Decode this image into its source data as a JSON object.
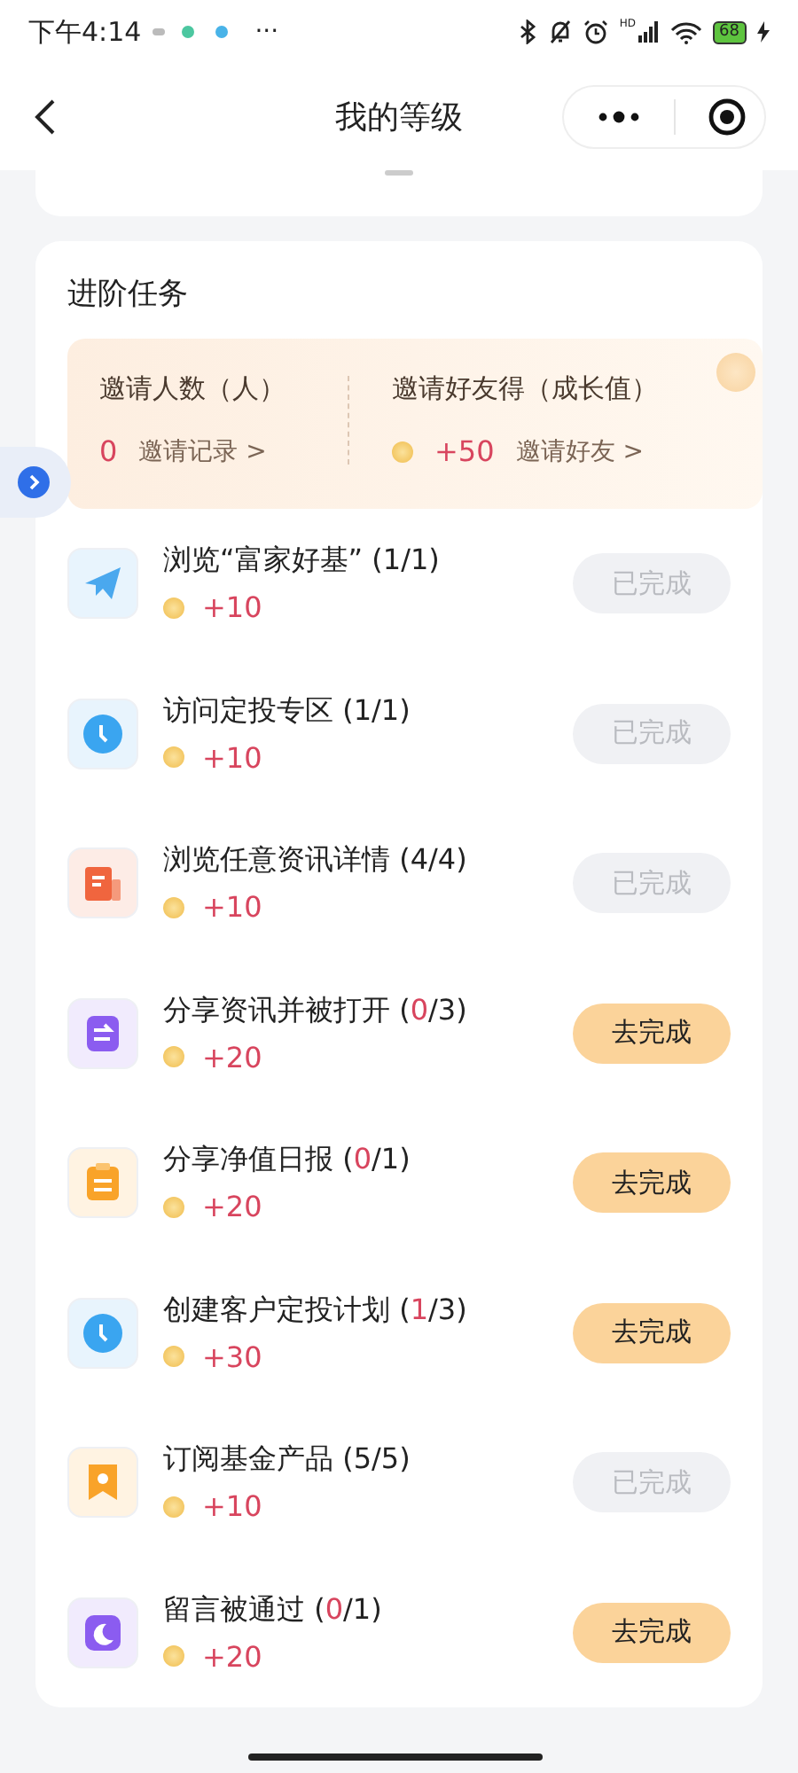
{
  "status_bar": {
    "time": "下午4:14",
    "more": "···",
    "network": "HD",
    "battery": "68"
  },
  "nav": {
    "title": "我的等级"
  },
  "section": {
    "title": "进阶任务"
  },
  "invite": {
    "left": {
      "title": "邀请人数（人）",
      "value": "0",
      "link": "邀请记录 >"
    },
    "right": {
      "title": "邀请好友得（成长值）",
      "value": "+50",
      "link": "邀请好友 >"
    }
  },
  "tasks": [
    {
      "kind": "plane",
      "title": "浏览“富家好基” (",
      "count": "1",
      "suffix": "/1)",
      "reward": "+10",
      "completed": true,
      "button": "已完成"
    },
    {
      "kind": "clock",
      "title": "访问定投专区 (",
      "count": "1",
      "suffix": "/1)",
      "reward": "+10",
      "completed": true,
      "button": "已完成"
    },
    {
      "kind": "news",
      "title": "浏览任意资讯详情 (",
      "count": "4",
      "suffix": "/4)",
      "reward": "+10",
      "completed": true,
      "button": "已完成"
    },
    {
      "kind": "share",
      "title": "分享资讯并被打开 (",
      "count": "0",
      "suffix": "/3)",
      "reward": "+20",
      "completed": false,
      "button": "去完成"
    },
    {
      "kind": "clipboard",
      "title": "分享净值日报 (",
      "count": "0",
      "suffix": "/1)",
      "reward": "+20",
      "completed": false,
      "button": "去完成"
    },
    {
      "kind": "clock",
      "title": "创建客户定投计划 (",
      "count": "1",
      "suffix": "/3)",
      "reward": "+30",
      "completed": false,
      "button": "去完成"
    },
    {
      "kind": "bookmark",
      "title": "订阅基金产品 (",
      "count": "5",
      "suffix": "/5)",
      "reward": "+10",
      "completed": true,
      "button": "已完成"
    },
    {
      "kind": "moon",
      "title": "留言被通过 (",
      "count": "0",
      "suffix": "/1)",
      "reward": "+20",
      "completed": false,
      "button": "去完成"
    }
  ]
}
